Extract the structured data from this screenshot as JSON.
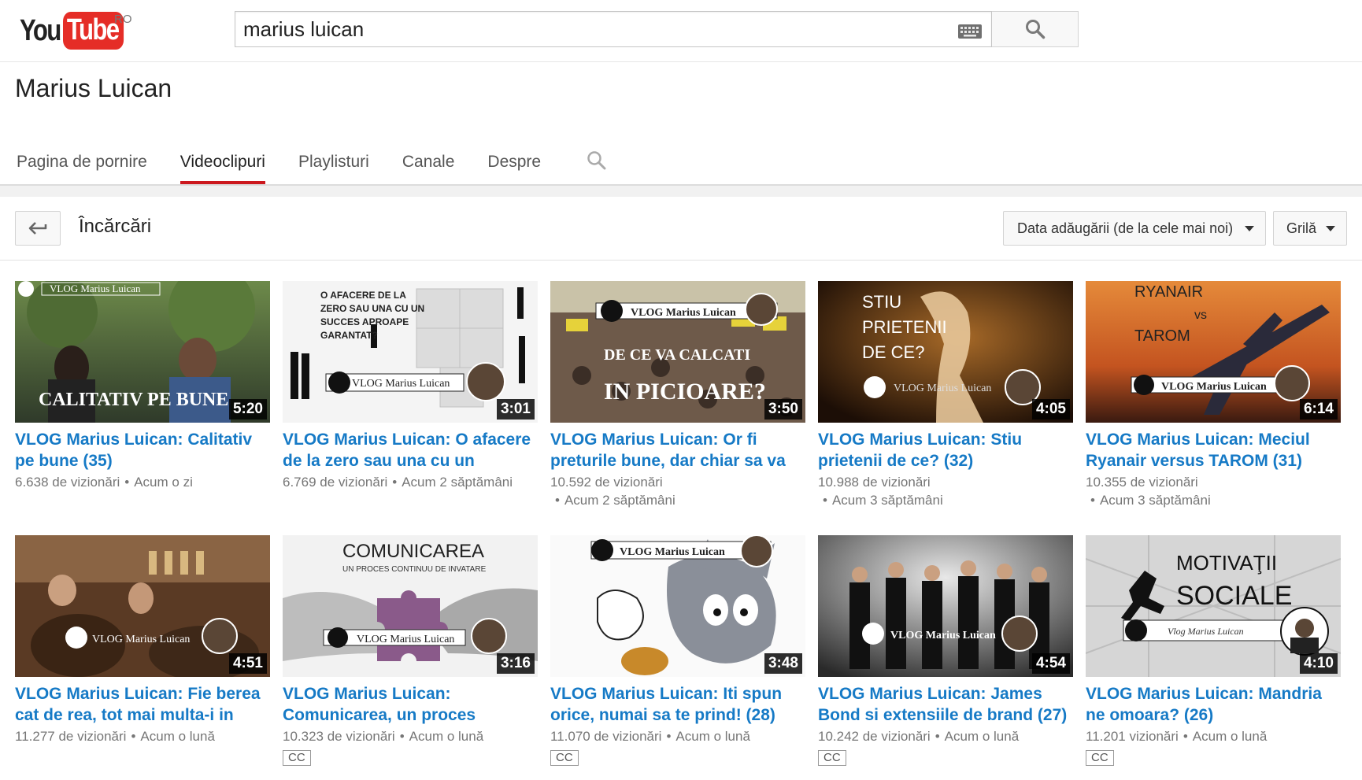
{
  "masthead": {
    "logo_you": "You",
    "logo_tube": "Tube",
    "region": "RO",
    "search_value": "marius luican"
  },
  "channel": {
    "name": "Marius Luican",
    "tabs": [
      {
        "label": "Pagina de pornire",
        "active": false
      },
      {
        "label": "Videoclipuri",
        "active": true
      },
      {
        "label": "Playlisturi",
        "active": false
      },
      {
        "label": "Canale",
        "active": false
      },
      {
        "label": "Despre",
        "active": false
      }
    ]
  },
  "uploads": {
    "title": "Încărcări",
    "sort_label": "Data adăugării (de la cele mai noi)",
    "view_label": "Grilă"
  },
  "videos": [
    {
      "title": "VLOG Marius Luican: Calitativ pe bune (35)",
      "views": "6.638 de vizionări",
      "age": "Acum o zi",
      "duration": "5:20",
      "thumb_text": "CALITATIV PE BUNE",
      "vlog_label": "VLOG Marius Luican",
      "cc": false
    },
    {
      "title": "VLOG Marius Luican: O afacere de la zero sau una cu un succes aproape garantat?",
      "views": "6.769 de vizionări",
      "age": "Acum 2 săptămâni",
      "duration": "3:01",
      "thumb_text": "O AFACERE DE LA ZERO SAU UNA CU UN SUCCES APROAPE GARANTAT?",
      "vlog_label": "VLOG Marius Luican",
      "cc": false
    },
    {
      "title": "VLOG Marius Luican: Or fi preturile bune, dar chiar sa va calcati in picioare?",
      "views": "10.592 de vizionări",
      "age": "Acum 2 săptămâni",
      "duration": "3:50",
      "thumb_text": "DE CE VA CALCATI IN PICIOARE?",
      "vlog_label": "VLOG Marius Luican",
      "cc": false
    },
    {
      "title": "VLOG Marius Luican: Stiu prietenii de ce? (32)",
      "views": "10.988 de vizionări",
      "age": "Acum 3 săptămâni",
      "duration": "4:05",
      "thumb_text": "STIU PRIETENII DE CE?",
      "vlog_label": "VLOG Marius Luican",
      "cc": false
    },
    {
      "title": "VLOG Marius Luican: Meciul Ryanair versus TAROM (31)",
      "views": "10.355 de vizionări",
      "age": "Acum 3 săptămâni",
      "duration": "6:14",
      "thumb_text": "RYANAIR vs TAROM",
      "vlog_label": "VLOG Marius Luican",
      "cc": false
    },
    {
      "title": "VLOG Marius Luican: Fie berea cat de rea, tot mai multa-i in tar...",
      "views": "11.277 de vizionări",
      "age": "Acum o lună",
      "duration": "4:51",
      "thumb_text": "",
      "vlog_label": "VLOG Marius Luican",
      "cc": false
    },
    {
      "title": "VLOG Marius Luican: Comunicarea, un proces contin...",
      "views": "10.323 de vizionări",
      "age": "Acum o lună",
      "duration": "3:16",
      "thumb_text": "COMUNICAREA",
      "thumb_sub": "UN PROCES CONTINUU DE INVATARE",
      "vlog_label": "VLOG Marius Luican",
      "cc": true
    },
    {
      "title": "VLOG Marius Luican: Iti spun orice, numai sa te prind! (28)",
      "views": "11.070 de vizionări",
      "age": "Acum o lună",
      "duration": "3:48",
      "thumb_text": "",
      "vlog_label": "VLOG Marius Luican",
      "cc": true
    },
    {
      "title": "VLOG Marius Luican: James Bond si extensiile de brand (27)",
      "views": "10.242 de vizionări",
      "age": "Acum o lună",
      "duration": "4:54",
      "thumb_text": "",
      "vlog_label": "VLOG Marius Luican",
      "cc": true
    },
    {
      "title": "VLOG Marius Luican: Mandria ne omoara? (26)",
      "views": "11.201 vizionări",
      "age": "Acum o lună",
      "duration": "4:10",
      "thumb_text": "MOTIVAŢII SOCIALE",
      "vlog_label": "Vlog Marius Luican",
      "cc": true
    }
  ],
  "cc_label": "CC",
  "colors": {
    "accent": "#cc181e",
    "link": "#167ac6",
    "logo_red": "#e52d27"
  },
  "icons": [
    "keyboard-icon",
    "search-icon",
    "back-arrow-icon",
    "chevron-down-icon"
  ]
}
